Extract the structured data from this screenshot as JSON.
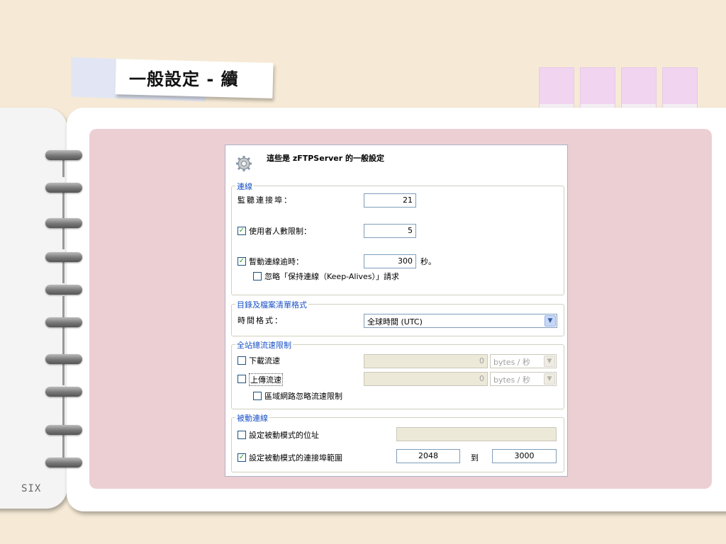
{
  "slide": {
    "title": "一般設定 - 續",
    "page_label": "SIX"
  },
  "dialog": {
    "header": "這些是 zFTPServer 的一般設定",
    "connection": {
      "group": "連線",
      "listen_port_label": "監聽連接埠：",
      "listen_port_value": "21",
      "user_limit_label": "使用者人數限制：",
      "user_limit_checked": true,
      "user_limit_value": "5",
      "idle_timeout_label": "暫動連線逾時：",
      "idle_timeout_checked": true,
      "idle_timeout_value": "300",
      "idle_timeout_unit": "秒。",
      "ignore_keepalive_label": "忽略「保持連線（Keep-Alives）」請求",
      "ignore_keepalive_checked": false
    },
    "listing": {
      "group": "目錄及檔案清單格式",
      "time_format_label": "時間格式：",
      "time_format_value": "全球時間 (UTC)"
    },
    "bandwidth": {
      "group": "全站總流速限制",
      "download_label": "下載流速",
      "download_checked": false,
      "download_value": "0",
      "download_unit": "bytes / 秒",
      "upload_label": "上傳流速",
      "upload_checked": false,
      "upload_value": "0",
      "upload_unit": "bytes / 秒",
      "lan_ignore_label": "區域網路忽略流速限制",
      "lan_ignore_checked": false
    },
    "passive": {
      "group": "被動連線",
      "address_label": "設定被動模式的位址",
      "address_checked": false,
      "address_value": "",
      "port_range_label": "設定被動模式的連接埠範圍",
      "port_range_checked": true,
      "port_from": "2048",
      "to_label": "到",
      "port_to": "3000"
    }
  },
  "colors": {
    "background": "#f6ead6",
    "pink_panel": "#eccfd3",
    "group_label": "#1a52c6",
    "tabs": "#f1d5f0"
  }
}
